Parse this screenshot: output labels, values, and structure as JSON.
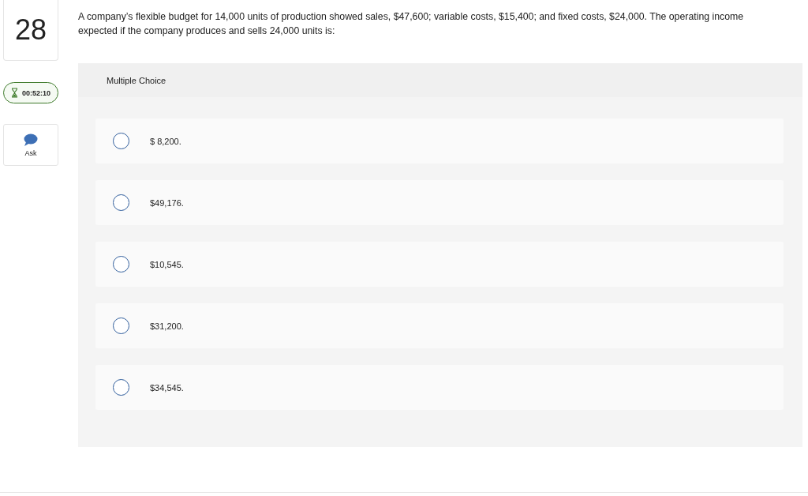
{
  "question": {
    "number": "28",
    "text": "A company’s flexible budget for 14,000 units of production showed sales, $47,600; variable costs, $15,400; and fixed costs, $24,000. The operating income expected if the company produces and sells 24,000 units is:"
  },
  "timer": {
    "time": "00:52:10"
  },
  "ask": {
    "label": "Ask"
  },
  "answer_panel": {
    "heading": "Multiple Choice",
    "options": [
      {
        "label": "$ 8,200.",
        "selected": false
      },
      {
        "label": "$49,176.",
        "selected": false
      },
      {
        "label": "$10,545.",
        "selected": false
      },
      {
        "label": "$31,200.",
        "selected": false
      },
      {
        "label": "$34,545.",
        "selected": false
      }
    ]
  }
}
